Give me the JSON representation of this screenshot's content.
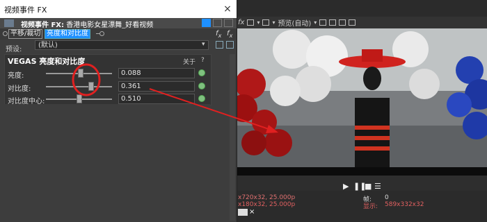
{
  "dialog": {
    "title": "视频事件 FX",
    "close": "×"
  },
  "fx_header": {
    "prefix": "视频事件 FX:",
    "name": "香港电影女星漂舞_好看视频"
  },
  "chain": {
    "items": [
      {
        "label": "平移/裁切"
      },
      {
        "label": "亮度和对比度"
      }
    ]
  },
  "preset": {
    "label": "预设:",
    "value": "(默认)"
  },
  "plugin": {
    "title": "VEGAS 亮度和对比度",
    "about": "关于",
    "help": "?",
    "params": [
      {
        "label": "亮度:",
        "value": "0.088",
        "level": 0.53
      },
      {
        "label": "对比度:",
        "value": "0.361",
        "level": 0.68
      },
      {
        "label": "对比度中心:",
        "value": "0.510",
        "level": 0.51
      }
    ]
  },
  "preview": {
    "quality": "预览(自动)",
    "info": {
      "project": "x720x32, 25.000p",
      "preview": "x180x32, 25.000p",
      "frame_label": "帧:",
      "frame_value": "0",
      "display_label": "显示:",
      "display_value": "589x332x32"
    }
  },
  "colors": {
    "accent": "#1e90ff",
    "annotation": "#e02020"
  }
}
